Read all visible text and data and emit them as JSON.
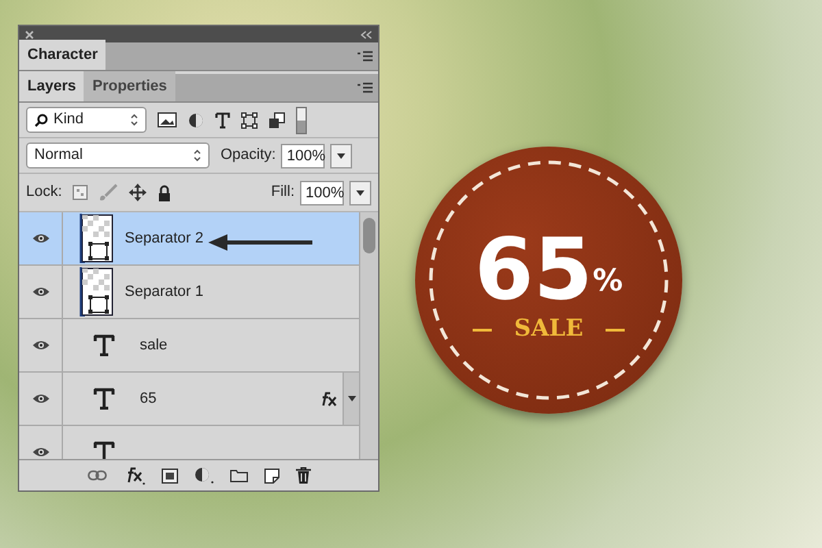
{
  "character_tab": {
    "label": "Character"
  },
  "tabs": [
    {
      "label": "Layers",
      "selected": true
    },
    {
      "label": "Properties",
      "selected": false
    }
  ],
  "filter": {
    "value": "Kind"
  },
  "blend_mode": {
    "value": "Normal"
  },
  "opacity": {
    "label": "Opacity:",
    "value": "100%"
  },
  "lock": {
    "label": "Lock:"
  },
  "fill": {
    "label": "Fill:",
    "value": "100%"
  },
  "layers": [
    {
      "name": "Separator 2",
      "kind": "shape",
      "visible": true,
      "selected": true,
      "fx": false
    },
    {
      "name": "Separator 1",
      "kind": "shape",
      "visible": true,
      "selected": false,
      "fx": false
    },
    {
      "name": "sale",
      "kind": "text",
      "visible": true,
      "selected": false,
      "fx": false
    },
    {
      "name": "65",
      "kind": "text",
      "visible": true,
      "selected": false,
      "fx": true
    },
    {
      "kind": "text",
      "visible": true,
      "selected": false,
      "fx": false
    }
  ],
  "badge": {
    "number": "65",
    "percent": "%",
    "label": "SALE"
  }
}
